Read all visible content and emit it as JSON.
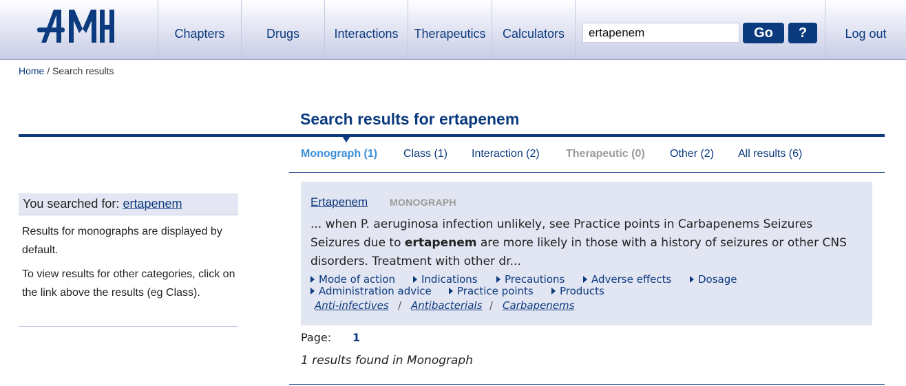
{
  "header": {
    "logo_text": "AMH",
    "nav": [
      "Chapters",
      "Drugs",
      "Interactions",
      "Therapeutics",
      "Calculators"
    ],
    "search_value": "ertapenem",
    "go_label": "Go",
    "help_label": "?",
    "logout_label": "Log out"
  },
  "breadcrumb": {
    "home": "Home",
    "separator": "/",
    "current": "Search results"
  },
  "page_title": "Search results for ertapenem",
  "tabs": [
    {
      "label": "Monograph (1)"
    },
    {
      "label": "Class (1)"
    },
    {
      "label": "Interaction (2)"
    },
    {
      "label": "Therapeutic (0)"
    },
    {
      "label": "Other (2)"
    },
    {
      "label": "All results (6)"
    }
  ],
  "sidebar": {
    "searched_prefix": "You searched for:",
    "searched_term": "ertapenem",
    "para1": "Results for monographs are displayed by default.",
    "para2": "To view results for other categories, click on the link above the results (eg Class)."
  },
  "result": {
    "title": "Ertapenem",
    "type": "MONOGRAPH",
    "snippet_before": "... when P. aeruginosa infection unlikely, see Practice points in Carbapenems Seizures Seizures due to ",
    "snippet_bold": "ertapenem",
    "snippet_after": " are more likely in those with a history of seizures or other CNS disorders. Treatment with other dr...",
    "sections": [
      "Mode of action",
      "Indications",
      "Precautions",
      "Adverse effects",
      "Dosage",
      "Administration advice",
      "Practice points",
      "Products"
    ],
    "classification": [
      "Anti-infectives",
      "Antibacterials",
      "Carbapenems"
    ],
    "class_separator": "/"
  },
  "pager": {
    "label": "Page:",
    "current": "1"
  },
  "result_count": "1 results found in Monograph",
  "colors": {
    "brand": "#0b3a7e",
    "active_tab": "#3a8fd8",
    "card_bg": "#e2e5f2",
    "disabled": "#9a9a9a"
  }
}
